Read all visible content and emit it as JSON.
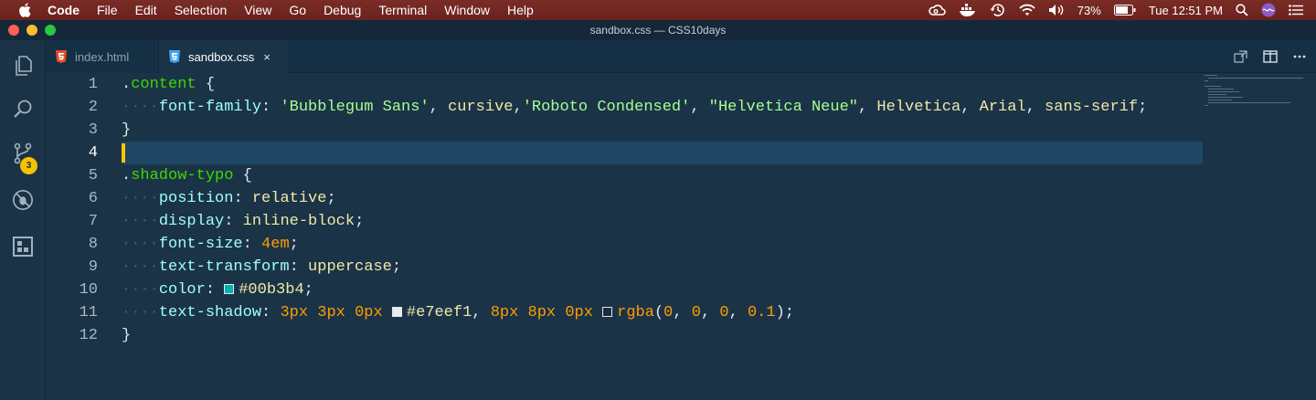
{
  "menubar": {
    "app_name": "Code",
    "items": [
      "File",
      "Edit",
      "Selection",
      "View",
      "Go",
      "Debug",
      "Terminal",
      "Window",
      "Help"
    ],
    "battery": "73%",
    "clock": "Tue 12:51 PM"
  },
  "window": {
    "title": "sandbox.css — CSS10days"
  },
  "activity_bar": {
    "scm_badge": "3"
  },
  "tabs": [
    {
      "label": "index.html",
      "icon": "html5-icon",
      "active": false
    },
    {
      "label": "sandbox.css",
      "icon": "css3-icon",
      "active": true,
      "close": "×"
    }
  ],
  "editor": {
    "line_numbers": [
      "1",
      "2",
      "3",
      "4",
      "5",
      "6",
      "7",
      "8",
      "9",
      "10",
      "11",
      "12"
    ],
    "current_line": "4",
    "code": {
      "l1_selector": "content",
      "l2_prop": "font-family",
      "l2_s1": "'Bubblegum Sans'",
      "l2_v1": "cursive",
      "l2_s2": "'Roboto Condensed'",
      "l2_s3": "\"Helvetica Neue\"",
      "l2_v2": "Helvetica",
      "l2_v3": "Arial",
      "l2_v4": "sans-serif",
      "l5_selector": "shadow-typo",
      "l6_prop": "position",
      "l6_val": "relative",
      "l7_prop": "display",
      "l7_val": "inline-block",
      "l8_prop": "font-size",
      "l8_num": "4",
      "l8_unit": "em",
      "l9_prop": "text-transform",
      "l9_val": "uppercase",
      "l10_prop": "color",
      "l10_val": "#00b3b4",
      "l11_prop": "text-shadow",
      "l11_c1": "#e7eef1",
      "l11_fn": "rgba",
      "l11_args": [
        "0",
        "0",
        "0",
        "0.1"
      ]
    },
    "colors": {
      "swatch_teal": "#00b3b4",
      "swatch_light": "#e7eef1",
      "swatch_rgba": "rgba(0,0,0,0.1)"
    }
  }
}
